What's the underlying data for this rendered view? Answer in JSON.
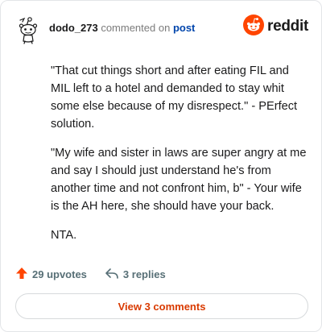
{
  "colors": {
    "accent": "#ff4500",
    "link": "#0045ac",
    "button_text": "#d93a00",
    "muted": "#576f76"
  },
  "header": {
    "avatar_icon": "snoo-avatar-icon",
    "username": "dodo_273",
    "commented_text": "commented on",
    "post_link": "post",
    "logo_icon": "reddit-logo-icon",
    "logo_text": "reddit"
  },
  "comment": {
    "paragraphs": [
      "\"That cut things short and after eating FIL and MIL left to a hotel and demanded to stay whit some else because of my disrespect.\" - PErfect solution.",
      "\"My wife and sister in laws are super angry at me and say I should just understand he's from another time and not confront him, b\" - Your wife is the AH here, she should have your back.",
      "NTA."
    ]
  },
  "footer": {
    "upvotes_icon": "upvote-arrow-icon",
    "upvotes_label": "29 upvotes",
    "replies_icon": "reply-arrow-icon",
    "replies_label": "3 replies"
  },
  "view_button": {
    "label": "View 3 comments"
  }
}
